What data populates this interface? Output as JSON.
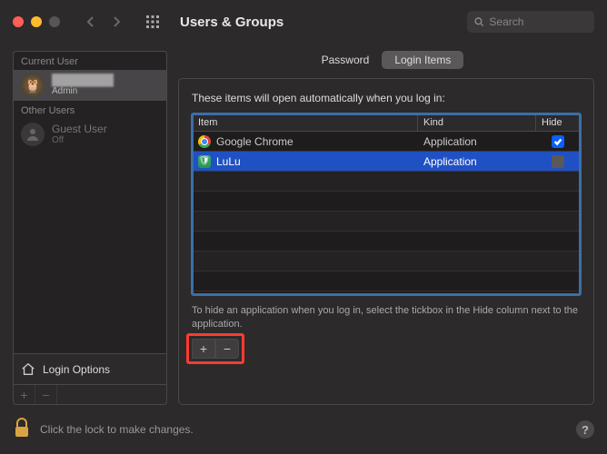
{
  "window": {
    "title": "Users & Groups",
    "search_placeholder": "Search"
  },
  "sidebar": {
    "current_user_label": "Current User",
    "other_users_label": "Other Users",
    "current_user": {
      "name": "████████",
      "role": "Admin"
    },
    "guest_user": {
      "name": "Guest User",
      "role": "Off"
    },
    "login_options_label": "Login Options"
  },
  "tabs": {
    "password": "Password",
    "login_items": "Login Items",
    "active": "login_items"
  },
  "panel": {
    "intro": "These items will open automatically when you log in:",
    "columns": {
      "item": "Item",
      "kind": "Kind",
      "hide": "Hide"
    },
    "rows": [
      {
        "name": "Google Chrome",
        "kind": "Application",
        "hide": true,
        "icon": "chrome",
        "selected": false
      },
      {
        "name": "LuLu",
        "kind": "Application",
        "hide": false,
        "icon": "lulu",
        "selected": true
      }
    ],
    "hint": "To hide an application when you log in, select the tickbox in the Hide column next to the application.",
    "add_btn": "+",
    "remove_btn": "−"
  },
  "footer": {
    "lock_text": "Click the lock to make changes.",
    "help": "?"
  },
  "colors": {
    "accent": "#0a60ff",
    "selection": "#2051c4",
    "highlight_box": "#ff3b30"
  }
}
